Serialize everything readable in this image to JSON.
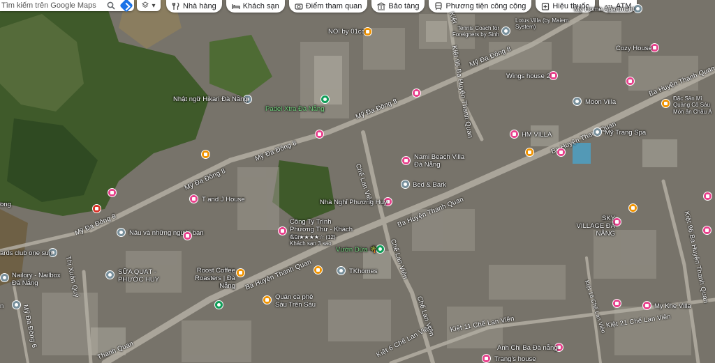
{
  "search": {
    "placeholder": "Tìm kiếm trên Google Maps"
  },
  "chips": [
    {
      "icon": "restaurant-icon",
      "label": "Nhà hàng"
    },
    {
      "icon": "hotel-icon",
      "label": "Khách sạn"
    },
    {
      "icon": "camera-icon",
      "label": "Điểm tham quan"
    },
    {
      "icon": "museum-icon",
      "label": "Bảo tàng"
    },
    {
      "icon": "transit-icon",
      "label": "Phương tiện công cộng"
    },
    {
      "icon": "pharmacy-icon",
      "label": "Hiệu thuốc"
    },
    {
      "icon": "atm-icon",
      "label": "ATM"
    }
  ],
  "layer_button": {
    "icon": "layers-icon",
    "arrow": "▾"
  },
  "streets": [
    {
      "name": "Mỹ Đa Đông 8"
    },
    {
      "name": "Mỹ Đa Đông 8"
    },
    {
      "name": "Mỹ Đa Đông 8"
    },
    {
      "name": "Mỹ Đa Đông 8"
    },
    {
      "name": "Mỹ Đa Đông 8"
    },
    {
      "name": "Ba Huyện Thanh Quan"
    },
    {
      "name": "Ba Huyện Thanh Quan"
    },
    {
      "name": "Ba Huyện Thanh Quan"
    },
    {
      "name": "Ba Huyện Thanh Quan"
    },
    {
      "name": "Ba Huyện Thanh Quan"
    },
    {
      "name": "Ba Huyện Thanh Quan"
    },
    {
      "name": "Chế Lan Viên"
    },
    {
      "name": "Chế Lan Viên"
    },
    {
      "name": "Chế Lan Viên"
    },
    {
      "name": "Kiệt 95 Ba Huyện Thanh Quan"
    },
    {
      "name": "Kiệt 96 Ba Huyện Thanh Quan"
    },
    {
      "name": "Kiệt 11 Chế Lan Viên"
    },
    {
      "name": "Kiệt 21 Chế Lan Viên"
    },
    {
      "name": "Kiệt 6 Chế Lan Viên"
    },
    {
      "name": "Kiệt 16 Chế Lan Viên"
    },
    {
      "name": "Thị Xuân Quý"
    },
    {
      "name": "Mỹ Đa Đông 6"
    },
    {
      "name": "Thanh Quan"
    },
    {
      "name": "Kiệt"
    }
  ],
  "places": [
    {
      "name": "NOI by 01cc",
      "type": "orange"
    },
    {
      "name": "Tennis Coach for Foreigners by Sinh",
      "type": "gray"
    },
    {
      "name": "Lotus Villa (by Maiem System)",
      "type": "gray"
    },
    {
      "name": "My Home Apartment",
      "type": "gray"
    },
    {
      "name": "Cozy House",
      "type": "pink"
    },
    {
      "name": "Wings house 2",
      "type": "pink"
    },
    {
      "name": "Nhật ngữ Hikari Đà Nẵng",
      "type": "gray"
    },
    {
      "name": "Padel Xtra Đà Nẵng",
      "type": "green"
    },
    {
      "name": "Moon Villa",
      "type": "gray"
    },
    {
      "name": "Đặc Sản Mì Quảng Cô Sáu",
      "type": "orange"
    },
    {
      "name": "Món ăn Châu Á",
      "type": "sub"
    },
    {
      "name": "HM VILLA",
      "type": "pink"
    },
    {
      "name": "Mỹ Trang Spa",
      "type": "gray"
    },
    {
      "name": "Nami Beach Villa Đà Nẵng",
      "type": "pink"
    },
    {
      "name": "Bed & Bark",
      "type": "gray"
    },
    {
      "name": "T and J House",
      "type": "pink"
    },
    {
      "name": "Nhà Nghỉ Phương Huy",
      "type": "pink"
    },
    {
      "name": "Công Ty Trình Phương Thư - Khách Sạn",
      "type": "pink"
    },
    {
      "name": "4.0 ★★★★☆ (12)",
      "type": "sub"
    },
    {
      "name": "Khách sạn 3 sao",
      "type": "sub"
    },
    {
      "name": "Nâu và những người bạn",
      "type": "gray"
    },
    {
      "name": "SKY VILLAGE ĐÀ NẴNG",
      "type": "pink"
    },
    {
      "name": "Vườn Dừa 🌴",
      "type": "green"
    },
    {
      "name": "ards club one sun",
      "type": "gray"
    },
    {
      "name": "SỮA QUẠT - PHƯỚC HUY",
      "type": "gray"
    },
    {
      "name": "Nailory - Nailbox Đà Nẵng",
      "type": "gray"
    },
    {
      "name": "Roost Coffee Roasters | Đà Nẵng",
      "type": "orange"
    },
    {
      "name": "TKhomes",
      "type": "gray"
    },
    {
      "name": "Quán cà phê Sáu Trên Sáu",
      "type": "orange"
    },
    {
      "name": "My Khe Villa",
      "type": "pink"
    },
    {
      "name": "Anh Chị Ba Đà nẵng",
      "type": "pink"
    },
    {
      "name": "Trang's house",
      "type": "pink"
    },
    {
      "name": "ong",
      "type": "none"
    },
    {
      "name": "n",
      "type": "none"
    }
  ],
  "colors": {
    "hotel": "#e8418c",
    "food": "#f09300",
    "generic": "#78909c",
    "park": "#0f9d58",
    "accent": "#1a73e8"
  }
}
